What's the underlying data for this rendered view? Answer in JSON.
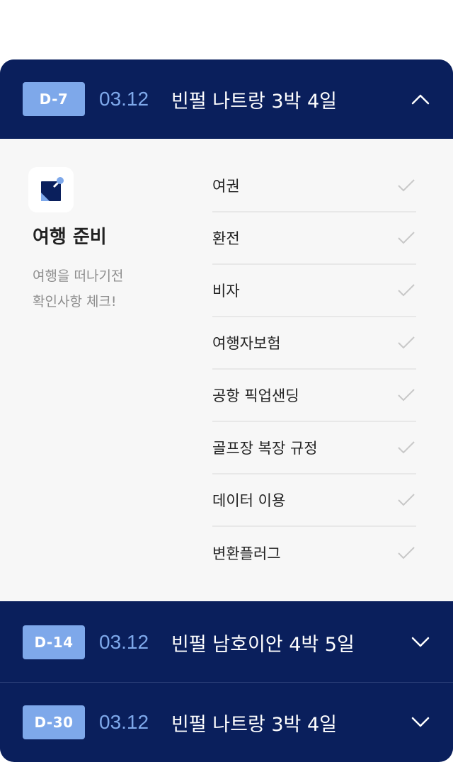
{
  "trips": [
    {
      "badge": "D-7",
      "date": "03.12",
      "title": "빈펄 나트랑 3박 4일",
      "expanded": true,
      "chevron_icon": "chevron-up-icon"
    },
    {
      "badge": "D-14",
      "date": "03.12",
      "title": "빈펄 남호이안 4박 5일",
      "expanded": false,
      "chevron_icon": "chevron-down-icon"
    },
    {
      "badge": "D-30",
      "date": "03.12",
      "title": "빈펄 나트랑 3박 4일",
      "expanded": false,
      "chevron_icon": "chevron-down-icon"
    }
  ],
  "prep": {
    "icon": "sticky-note-pin-icon",
    "title": "여행 준비",
    "desc_line1": "여행을 떠나기전",
    "desc_line2": "확인사항 체크!",
    "items": [
      {
        "label": "여권",
        "checked": false
      },
      {
        "label": "환전",
        "checked": false
      },
      {
        "label": "비자",
        "checked": false
      },
      {
        "label": "여행자보험",
        "checked": false
      },
      {
        "label": "공항 픽업샌딩",
        "checked": false
      },
      {
        "label": "골프장 복장 규정",
        "checked": false
      },
      {
        "label": "데이터 이용",
        "checked": false
      },
      {
        "label": "변환플러그",
        "checked": false
      }
    ]
  },
  "colors": {
    "navy": "#0a1f5c",
    "badge_blue": "#7ea8ea",
    "panel_bg": "#f7f7f7",
    "check_gray": "#c8c8c8"
  }
}
